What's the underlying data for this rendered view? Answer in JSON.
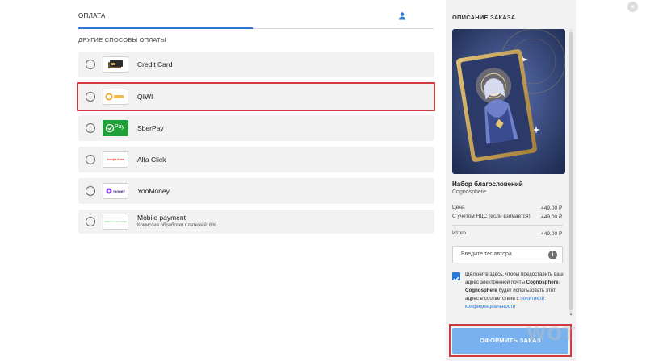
{
  "checkout": {
    "tabs": [
      {
        "label": "ОПЛАТА",
        "active": true
      }
    ],
    "user_icon": "user-icon",
    "section_title": "ДРУГИЕ СПОСОБЫ ОПЛАТЫ",
    "payment_methods": [
      {
        "label": "Credit Card",
        "icon": "credit-card-icon",
        "selected": false,
        "highlighted": false
      },
      {
        "label": "QIWI",
        "icon": "qiwi-logo",
        "logo_text": "QIWI",
        "selected": false,
        "highlighted": true
      },
      {
        "label": "SberPay",
        "icon": "sberpay-logo",
        "logo_text": "Pay",
        "selected": false,
        "highlighted": false
      },
      {
        "label": "Alfa Click",
        "icon": "alfa-click-logo",
        "logo_text": "Альфа-Клик",
        "selected": false,
        "highlighted": false
      },
      {
        "label": "YooMoney",
        "icon": "yoomoney-logo",
        "logo_text": "money",
        "selected": false,
        "highlighted": false
      },
      {
        "label": "Mobile payment",
        "sublabel": "Комиссия обработки платежей: 6%",
        "icon": "mobile-payment-logo",
        "logo_text": "Мобильный платёж",
        "selected": false,
        "highlighted": false
      }
    ]
  },
  "order": {
    "title": "ОПИСАНИЕ ЗАКАЗА",
    "product_name": "Набор благословений",
    "developer": "Cognosphere",
    "price_label": "Цена",
    "price_value": "449,00 ₽",
    "vat_label": "С учётом НДС (если взимается)",
    "vat_value": "449,00 ₽",
    "total_label": "Итого",
    "total_value": "449,00 ₽",
    "creator_tag_placeholder": "Введите тег автора",
    "consent": {
      "checked": true,
      "part1": "Щёлкните здесь, чтобы предоставить ваш адрес электронной почты ",
      "bold1": "Cognosphere",
      "part2": ". ",
      "bold2": "Cognosphere",
      "part3": " будет использовать этот адрес в соответствии с ",
      "link": "политикой конфиденциальности"
    },
    "place_order_label": "ОФОРМИТЬ ЗАКАЗ"
  },
  "watermark": "WOT",
  "close_label": "×",
  "colors": {
    "accent": "#2a7ad5",
    "button": "#78b1ef",
    "highlight": "#d0393e",
    "method_bg": "#f2f2f2",
    "panel_bg": "#f2f2f2"
  }
}
